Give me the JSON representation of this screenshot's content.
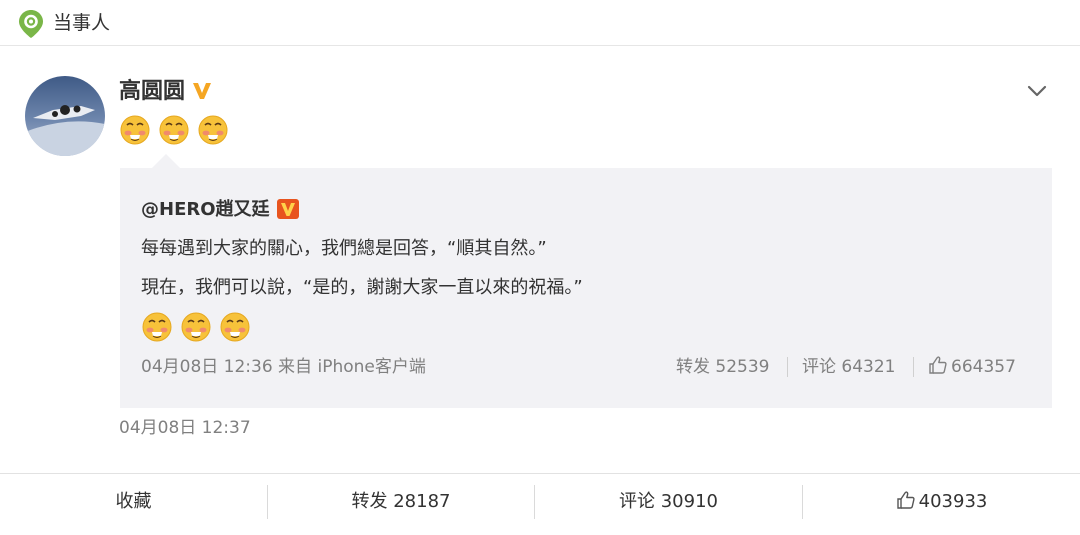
{
  "header": {
    "title": "当事人",
    "icon": "location-pin-icon",
    "accent": "#7ab648"
  },
  "post": {
    "author": "高圆圆",
    "verified_badge": "verified-v-icon",
    "emojis": [
      "blushing-face-icon",
      "blushing-face-icon",
      "blushing-face-icon"
    ],
    "timestamp": "04月08日 12:37"
  },
  "quoted": {
    "author": "@HERO趙又廷",
    "verified_badge": "verified-v-icon",
    "line1": "每每遇到大家的關心，我們總是回答，“順其自然。”",
    "line2": "現在，我們可以說，“是的，謝謝大家一直以來的祝福。”",
    "emojis": [
      "blushing-face-icon",
      "blushing-face-icon",
      "blushing-face-icon"
    ],
    "meta": "04月08日 12:36 来自 iPhone客户端",
    "repost": "转发 52539",
    "comment": "评论 64321",
    "likes": "664357"
  },
  "actions": {
    "collect": "收藏",
    "repost": "转发 28187",
    "comment": "评论 30910",
    "likes": "403933"
  },
  "colors": {
    "badge_orange": "#f5a623",
    "badge_red": "#e8541e",
    "quote_bg": "#f2f2f5"
  }
}
